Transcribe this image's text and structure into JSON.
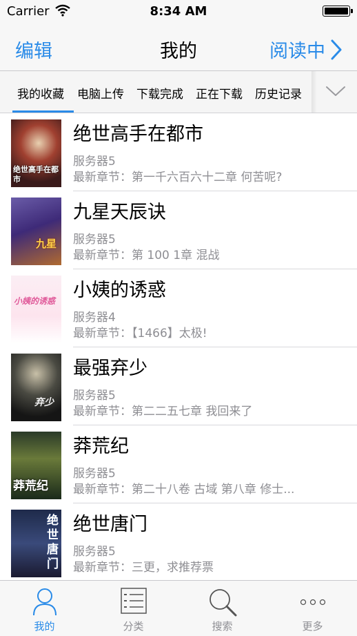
{
  "status_bar": {
    "carrier": "Carrier",
    "time": "8:34 AM"
  },
  "nav": {
    "edit_label": "编辑",
    "title": "我的",
    "reading_label": "阅读中"
  },
  "tabs": [
    {
      "label": "我的收藏",
      "active": true
    },
    {
      "label": "电脑上传",
      "active": false
    },
    {
      "label": "下载完成",
      "active": false
    },
    {
      "label": "正在下载",
      "active": false
    },
    {
      "label": "历史记录",
      "active": false
    }
  ],
  "books": [
    {
      "title": "绝世高手在都市",
      "server": "服务器5",
      "latest": "最新章节：第一千六百六十二章 何苦呢?",
      "cover_text": "绝世高手在都市"
    },
    {
      "title": "九星天辰诀",
      "server": "服务器5",
      "latest": "最新章节：第 100 1章 混战",
      "cover_text": "九星"
    },
    {
      "title": "小姨的诱惑",
      "server": "服务器4",
      "latest": "最新章节：【1466】太极!",
      "cover_text": "小姨的诱惑"
    },
    {
      "title": "最强弃少",
      "server": "服务器5",
      "latest": "最新章节：第二二五七章 我回来了",
      "cover_text": "弃少"
    },
    {
      "title": "莽荒纪",
      "server": "服务器5",
      "latest": "最新章节：第二十八卷 古域 第八章 修士...",
      "cover_text": "莽荒纪"
    },
    {
      "title": "绝世唐门",
      "server": "服务器5",
      "latest": "最新章节：三更，求推荐票",
      "cover_text": "绝世唐门"
    }
  ],
  "tabbar": [
    {
      "label": "我的",
      "icon": "person-icon",
      "active": true
    },
    {
      "label": "分类",
      "icon": "list-icon",
      "active": false
    },
    {
      "label": "搜索",
      "icon": "search-icon",
      "active": false
    },
    {
      "label": "更多",
      "icon": "more-icon",
      "active": false
    }
  ],
  "colors": {
    "accent": "#2a8be8",
    "secondary_text": "#8e8e93"
  }
}
